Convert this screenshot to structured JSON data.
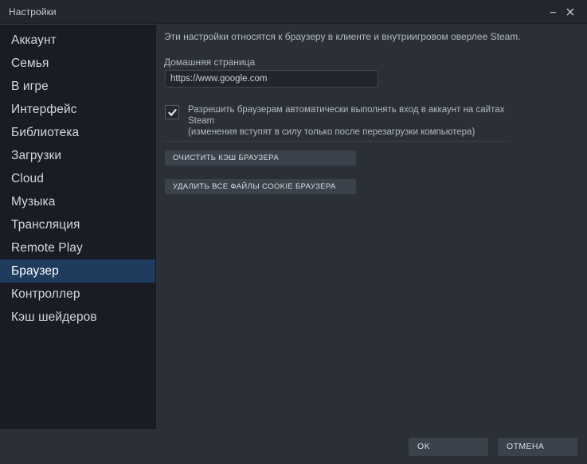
{
  "window": {
    "title": "Настройки",
    "minimize_icon": "minimize-icon",
    "close_icon": "close-icon"
  },
  "sidebar": {
    "items": [
      {
        "label": "Аккаунт",
        "selected": false
      },
      {
        "label": "Семья",
        "selected": false
      },
      {
        "label": "В игре",
        "selected": false
      },
      {
        "label": "Интерфейс",
        "selected": false
      },
      {
        "label": "Библиотека",
        "selected": false
      },
      {
        "label": "Загрузки",
        "selected": false
      },
      {
        "label": "Cloud",
        "selected": false
      },
      {
        "label": "Музыка",
        "selected": false
      },
      {
        "label": "Трансляция",
        "selected": false
      },
      {
        "label": "Remote Play",
        "selected": false
      },
      {
        "label": "Браузер",
        "selected": true
      },
      {
        "label": "Контроллер",
        "selected": false
      },
      {
        "label": "Кэш шейдеров",
        "selected": false
      }
    ],
    "selected_label": "Браузер"
  },
  "content": {
    "intro": "Эти настройки относятся к браузеру в клиенте и внутриигровом оверлее Steam.",
    "home_page_label": "Домашняя страница",
    "home_page_value": "https://www.google.com",
    "home_page_placeholder": "https://",
    "checkbox": {
      "checked": true,
      "line1": "Разрешить браузерам автоматически выполнять вход в аккаунт на сайтах Steam",
      "line2": "(изменения вступят в силу только после перезагрузки компьютера)"
    },
    "clear_cache_button": "ОЧИСТИТЬ КЭШ БРАУЗЕРА",
    "delete_cookies_button": "УДАЛИТЬ ВСЕ ФАЙЛЫ COOKIE БРАУЗЕРА"
  },
  "footer": {
    "ok_button": "OK",
    "cancel_button": "ОТМЕНА"
  },
  "colors": {
    "titlebar_bg": "#23262d",
    "sidebar_bg": "#191c22",
    "content_bg": "#2b2f36",
    "selected_nav_bg": "#1f3c5e",
    "button_bg": "#3c424b",
    "text_primary": "#d3d9de",
    "text_secondary": "#b4bbc3"
  }
}
